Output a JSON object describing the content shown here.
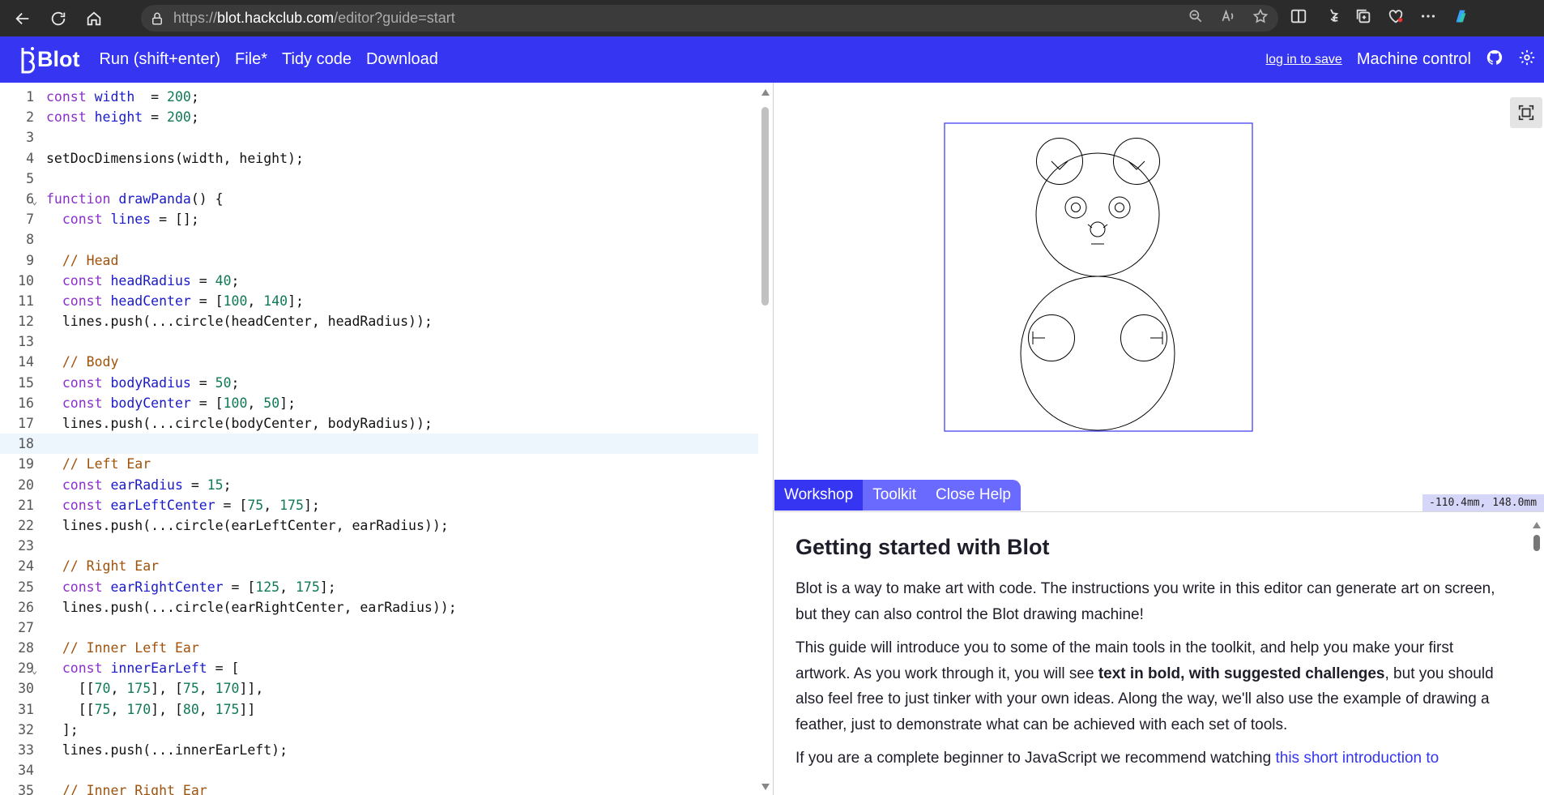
{
  "browser": {
    "url_prefix": "https://",
    "url_host": "blot.hackclub.com",
    "url_path": "/editor?guide=start"
  },
  "header": {
    "logo_text": "Blot",
    "menu": [
      "Run (shift+enter)",
      "File*",
      "Tidy code",
      "Download"
    ],
    "login": "log in to save",
    "machine": "Machine control"
  },
  "editor": {
    "active_line": 18,
    "fold_lines": [
      6,
      29
    ],
    "lines": [
      [
        [
          "kw",
          "const "
        ],
        [
          "vn",
          "width"
        ],
        [
          "",
          "  = "
        ],
        [
          "num",
          "200"
        ],
        [
          "",
          ";"
        ]
      ],
      [
        [
          "kw",
          "const "
        ],
        [
          "vn",
          "height"
        ],
        [
          "",
          " = "
        ],
        [
          "num",
          "200"
        ],
        [
          "",
          ";"
        ]
      ],
      [],
      [
        [
          "",
          "setDocDimensions(width, height);"
        ]
      ],
      [],
      [
        [
          "kw",
          "function "
        ],
        [
          "vn",
          "drawPanda"
        ],
        [
          "",
          "() {"
        ]
      ],
      [
        [
          "",
          "  "
        ],
        [
          "kw",
          "const "
        ],
        [
          "vn",
          "lines"
        ],
        [
          "",
          " = [];"
        ]
      ],
      [],
      [
        [
          "",
          "  "
        ],
        [
          "cm",
          "// Head"
        ]
      ],
      [
        [
          "",
          "  "
        ],
        [
          "kw",
          "const "
        ],
        [
          "vn",
          "headRadius"
        ],
        [
          "",
          " = "
        ],
        [
          "num",
          "40"
        ],
        [
          "",
          ";"
        ]
      ],
      [
        [
          "",
          "  "
        ],
        [
          "kw",
          "const "
        ],
        [
          "vn",
          "headCenter"
        ],
        [
          "",
          " = ["
        ],
        [
          "num",
          "100"
        ],
        [
          "",
          ", "
        ],
        [
          "num",
          "140"
        ],
        [
          "",
          "];"
        ]
      ],
      [
        [
          "",
          "  lines.push(...circle(headCenter, headRadius));"
        ]
      ],
      [],
      [
        [
          "",
          "  "
        ],
        [
          "cm",
          "// Body"
        ]
      ],
      [
        [
          "",
          "  "
        ],
        [
          "kw",
          "const "
        ],
        [
          "vn",
          "bodyRadius"
        ],
        [
          "",
          " = "
        ],
        [
          "num",
          "50"
        ],
        [
          "",
          ";"
        ]
      ],
      [
        [
          "",
          "  "
        ],
        [
          "kw",
          "const "
        ],
        [
          "vn",
          "bodyCenter"
        ],
        [
          "",
          " = ["
        ],
        [
          "num",
          "100"
        ],
        [
          "",
          ", "
        ],
        [
          "num",
          "50"
        ],
        [
          "",
          "];"
        ]
      ],
      [
        [
          "",
          "  lines.push(...circle(bodyCenter, bodyRadius));"
        ]
      ],
      [],
      [
        [
          "",
          "  "
        ],
        [
          "cm",
          "// Left Ear"
        ]
      ],
      [
        [
          "",
          "  "
        ],
        [
          "kw",
          "const "
        ],
        [
          "vn",
          "earRadius"
        ],
        [
          "",
          " = "
        ],
        [
          "num",
          "15"
        ],
        [
          "",
          ";"
        ]
      ],
      [
        [
          "",
          "  "
        ],
        [
          "kw",
          "const "
        ],
        [
          "vn",
          "earLeftCenter"
        ],
        [
          "",
          " = ["
        ],
        [
          "num",
          "75"
        ],
        [
          "",
          ", "
        ],
        [
          "num",
          "175"
        ],
        [
          "",
          "];"
        ]
      ],
      [
        [
          "",
          "  lines.push(...circle(earLeftCenter, earRadius));"
        ]
      ],
      [],
      [
        [
          "",
          "  "
        ],
        [
          "cm",
          "// Right Ear"
        ]
      ],
      [
        [
          "",
          "  "
        ],
        [
          "kw",
          "const "
        ],
        [
          "vn",
          "earRightCenter"
        ],
        [
          "",
          " = ["
        ],
        [
          "num",
          "125"
        ],
        [
          "",
          ", "
        ],
        [
          "num",
          "175"
        ],
        [
          "",
          "];"
        ]
      ],
      [
        [
          "",
          "  lines.push(...circle(earRightCenter, earRadius));"
        ]
      ],
      [],
      [
        [
          "",
          "  "
        ],
        [
          "cm",
          "// Inner Left Ear"
        ]
      ],
      [
        [
          "",
          "  "
        ],
        [
          "kw",
          "const "
        ],
        [
          "vn",
          "innerEarLeft"
        ],
        [
          "",
          " = ["
        ]
      ],
      [
        [
          "",
          "    [["
        ],
        [
          "num",
          "70"
        ],
        [
          "",
          ", "
        ],
        [
          "num",
          "175"
        ],
        [
          "",
          "], ["
        ],
        [
          "num",
          "75"
        ],
        [
          "",
          ", "
        ],
        [
          "num",
          "170"
        ],
        [
          "",
          "]],"
        ]
      ],
      [
        [
          "",
          "    [["
        ],
        [
          "num",
          "75"
        ],
        [
          "",
          ", "
        ],
        [
          "num",
          "170"
        ],
        [
          "",
          "], ["
        ],
        [
          "num",
          "80"
        ],
        [
          "",
          ", "
        ],
        [
          "num",
          "175"
        ],
        [
          "",
          "]]"
        ]
      ],
      [
        [
          "",
          "  ];"
        ]
      ],
      [
        [
          "",
          "  lines.push(...innerEarLeft);"
        ]
      ],
      [],
      [
        [
          "",
          "  "
        ],
        [
          "cm",
          "// Inner Right Ear"
        ]
      ]
    ]
  },
  "preview": {
    "coords": "-110.4mm,  148.0mm"
  },
  "help": {
    "tabs": [
      "Workshop",
      "Toolkit",
      "Close Help"
    ],
    "active_tab": 0,
    "title": "Getting started with Blot",
    "p1": "Blot is a way to make art with code. The instructions you write in this editor can generate art on screen, but they can also control the Blot drawing machine!",
    "p2_a": "This guide will introduce you to some of the main tools in the toolkit, and help you make your first artwork. As you work through it, you will see ",
    "p2_bold": "text in bold, with suggested challenges",
    "p2_b": ", but you should also feel free to just tinker with your own ideas. Along the way, we'll also use the example of drawing a feather, just to demonstrate what can be achieved with each set of tools.",
    "p3_a": "If you are a complete beginner to JavaScript we recommend watching ",
    "p3_link": "this short introduction to"
  },
  "colors": {
    "brand": "#3535f2",
    "tab_bg": "#6a6aff"
  }
}
